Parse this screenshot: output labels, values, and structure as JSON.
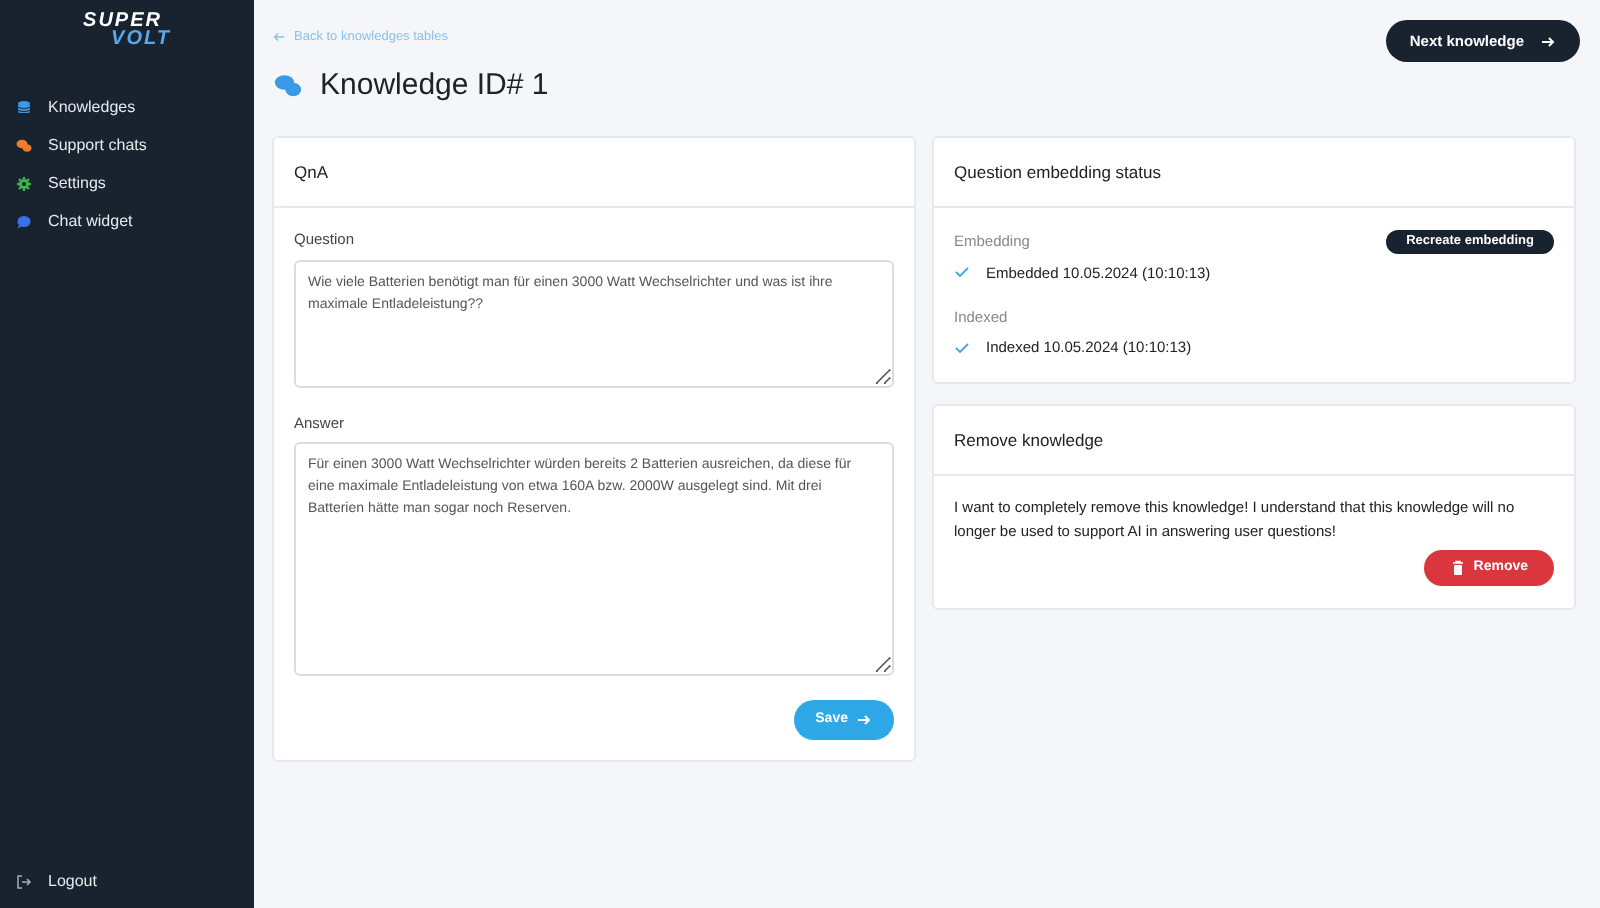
{
  "sidebar": {
    "logo": {
      "top": "SUPER",
      "bottom": "VOLT"
    },
    "items": [
      {
        "label": "Knowledges",
        "kind": "database",
        "color": "#3b9ae8"
      },
      {
        "label": "Support chats",
        "kind": "chats",
        "color": "#f07c2a"
      },
      {
        "label": "Settings",
        "kind": "gear",
        "color": "#3ab44a"
      },
      {
        "label": "Chat widget",
        "kind": "bubble",
        "color": "#3b6fe8"
      }
    ],
    "logout": "Logout"
  },
  "back_link": "Back to knowledges tables",
  "title": "Knowledge ID# 1",
  "next_button": "Next knowledge",
  "qna": {
    "title": "QnA",
    "question_label": "Question",
    "question": "Wie viele Batterien benötigt man für einen 3000 Watt Wechselrichter und was ist ihre maximale Entladeleistung??",
    "answer_label": "Answer",
    "answer": "Für einen 3000 Watt Wechselrichter würden bereits 2 Batterien ausreichen, da diese für eine maximale Entladeleistung von etwa 160A bzw. 2000W ausgelegt sind. Mit drei Batterien hätte man sogar noch Reserven.",
    "save": "Save"
  },
  "status": {
    "title": "Question embedding status",
    "recreate": "Recreate embedding",
    "entries": [
      {
        "label": "Embedding",
        "value": "Embedded 10.05.2024 (10:10:13)",
        "checked": true
      },
      {
        "label": "Indexed",
        "value": "Indexed 10.05.2024 (10:10:13)",
        "checked": true
      }
    ]
  },
  "remove": {
    "title": "Remove knowledge",
    "text": "I want to completely remove this knowledge! I understand that this knowledge will no longer be used to support AI in answering user questions!",
    "button": "Remove"
  }
}
